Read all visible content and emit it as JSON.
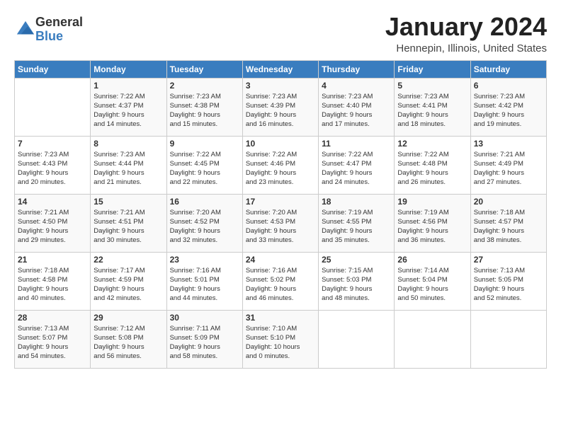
{
  "logo": {
    "general": "General",
    "blue": "Blue"
  },
  "title": "January 2024",
  "location": "Hennepin, Illinois, United States",
  "days_header": [
    "Sunday",
    "Monday",
    "Tuesday",
    "Wednesday",
    "Thursday",
    "Friday",
    "Saturday"
  ],
  "weeks": [
    [
      {
        "num": "",
        "info": ""
      },
      {
        "num": "1",
        "info": "Sunrise: 7:22 AM\nSunset: 4:37 PM\nDaylight: 9 hours\nand 14 minutes."
      },
      {
        "num": "2",
        "info": "Sunrise: 7:23 AM\nSunset: 4:38 PM\nDaylight: 9 hours\nand 15 minutes."
      },
      {
        "num": "3",
        "info": "Sunrise: 7:23 AM\nSunset: 4:39 PM\nDaylight: 9 hours\nand 16 minutes."
      },
      {
        "num": "4",
        "info": "Sunrise: 7:23 AM\nSunset: 4:40 PM\nDaylight: 9 hours\nand 17 minutes."
      },
      {
        "num": "5",
        "info": "Sunrise: 7:23 AM\nSunset: 4:41 PM\nDaylight: 9 hours\nand 18 minutes."
      },
      {
        "num": "6",
        "info": "Sunrise: 7:23 AM\nSunset: 4:42 PM\nDaylight: 9 hours\nand 19 minutes."
      }
    ],
    [
      {
        "num": "7",
        "info": "Sunrise: 7:23 AM\nSunset: 4:43 PM\nDaylight: 9 hours\nand 20 minutes."
      },
      {
        "num": "8",
        "info": "Sunrise: 7:23 AM\nSunset: 4:44 PM\nDaylight: 9 hours\nand 21 minutes."
      },
      {
        "num": "9",
        "info": "Sunrise: 7:22 AM\nSunset: 4:45 PM\nDaylight: 9 hours\nand 22 minutes."
      },
      {
        "num": "10",
        "info": "Sunrise: 7:22 AM\nSunset: 4:46 PM\nDaylight: 9 hours\nand 23 minutes."
      },
      {
        "num": "11",
        "info": "Sunrise: 7:22 AM\nSunset: 4:47 PM\nDaylight: 9 hours\nand 24 minutes."
      },
      {
        "num": "12",
        "info": "Sunrise: 7:22 AM\nSunset: 4:48 PM\nDaylight: 9 hours\nand 26 minutes."
      },
      {
        "num": "13",
        "info": "Sunrise: 7:21 AM\nSunset: 4:49 PM\nDaylight: 9 hours\nand 27 minutes."
      }
    ],
    [
      {
        "num": "14",
        "info": "Sunrise: 7:21 AM\nSunset: 4:50 PM\nDaylight: 9 hours\nand 29 minutes."
      },
      {
        "num": "15",
        "info": "Sunrise: 7:21 AM\nSunset: 4:51 PM\nDaylight: 9 hours\nand 30 minutes."
      },
      {
        "num": "16",
        "info": "Sunrise: 7:20 AM\nSunset: 4:52 PM\nDaylight: 9 hours\nand 32 minutes."
      },
      {
        "num": "17",
        "info": "Sunrise: 7:20 AM\nSunset: 4:53 PM\nDaylight: 9 hours\nand 33 minutes."
      },
      {
        "num": "18",
        "info": "Sunrise: 7:19 AM\nSunset: 4:55 PM\nDaylight: 9 hours\nand 35 minutes."
      },
      {
        "num": "19",
        "info": "Sunrise: 7:19 AM\nSunset: 4:56 PM\nDaylight: 9 hours\nand 36 minutes."
      },
      {
        "num": "20",
        "info": "Sunrise: 7:18 AM\nSunset: 4:57 PM\nDaylight: 9 hours\nand 38 minutes."
      }
    ],
    [
      {
        "num": "21",
        "info": "Sunrise: 7:18 AM\nSunset: 4:58 PM\nDaylight: 9 hours\nand 40 minutes."
      },
      {
        "num": "22",
        "info": "Sunrise: 7:17 AM\nSunset: 4:59 PM\nDaylight: 9 hours\nand 42 minutes."
      },
      {
        "num": "23",
        "info": "Sunrise: 7:16 AM\nSunset: 5:01 PM\nDaylight: 9 hours\nand 44 minutes."
      },
      {
        "num": "24",
        "info": "Sunrise: 7:16 AM\nSunset: 5:02 PM\nDaylight: 9 hours\nand 46 minutes."
      },
      {
        "num": "25",
        "info": "Sunrise: 7:15 AM\nSunset: 5:03 PM\nDaylight: 9 hours\nand 48 minutes."
      },
      {
        "num": "26",
        "info": "Sunrise: 7:14 AM\nSunset: 5:04 PM\nDaylight: 9 hours\nand 50 minutes."
      },
      {
        "num": "27",
        "info": "Sunrise: 7:13 AM\nSunset: 5:05 PM\nDaylight: 9 hours\nand 52 minutes."
      }
    ],
    [
      {
        "num": "28",
        "info": "Sunrise: 7:13 AM\nSunset: 5:07 PM\nDaylight: 9 hours\nand 54 minutes."
      },
      {
        "num": "29",
        "info": "Sunrise: 7:12 AM\nSunset: 5:08 PM\nDaylight: 9 hours\nand 56 minutes."
      },
      {
        "num": "30",
        "info": "Sunrise: 7:11 AM\nSunset: 5:09 PM\nDaylight: 9 hours\nand 58 minutes."
      },
      {
        "num": "31",
        "info": "Sunrise: 7:10 AM\nSunset: 5:10 PM\nDaylight: 10 hours\nand 0 minutes."
      },
      {
        "num": "",
        "info": ""
      },
      {
        "num": "",
        "info": ""
      },
      {
        "num": "",
        "info": ""
      }
    ]
  ]
}
